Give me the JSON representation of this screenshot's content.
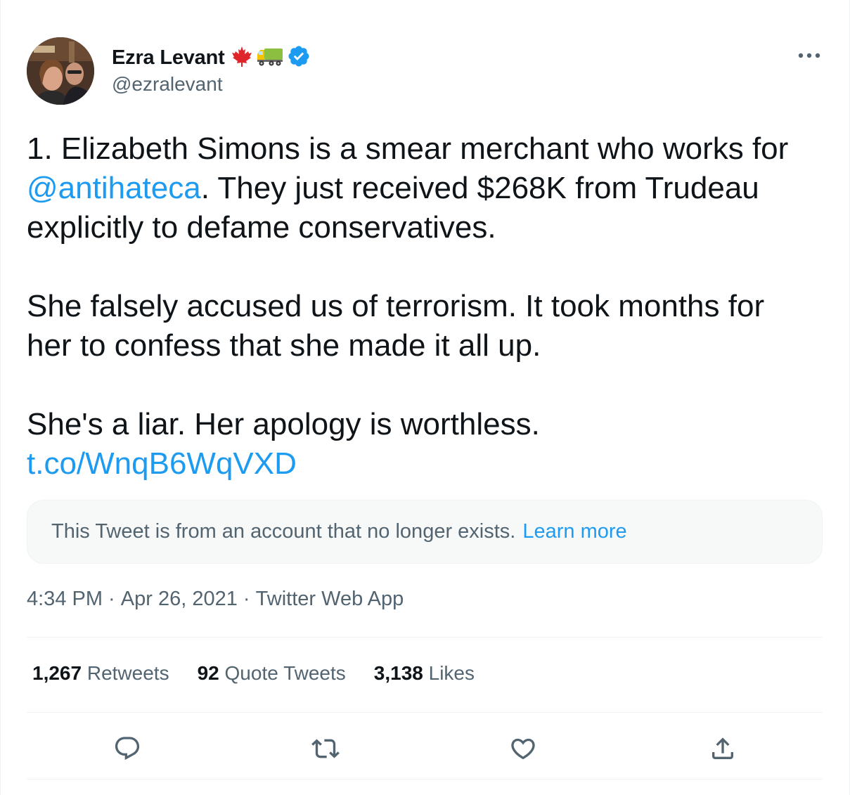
{
  "author": {
    "display_name": "Ezra Levant",
    "handle": "@ezralevant",
    "badges": [
      "maple-leaf-icon",
      "truck-icon",
      "verified-icon"
    ]
  },
  "tweet": {
    "line1": "1. Elizabeth Simons is a smear merchant who works for",
    "mention": "@antihateca",
    "line2_rest": ". They just received $268K from Trudeau",
    "line3": "explicitly to defame conservatives.",
    "para2_line1": "She falsely accused us of terrorism. It took months for",
    "para2_line2": "her to confess that she made it all up.",
    "para3_line1": "She's a liar. Her apology is worthless.",
    "link": "t.co/WnqB6WqVXD"
  },
  "quoted_notice": {
    "text": "This Tweet is from an account that no longer exists.",
    "learn_more": "Learn more"
  },
  "meta": {
    "time": "4:34 PM",
    "separator": " · ",
    "date": "Apr 26, 2021",
    "source": "Twitter Web App"
  },
  "stats": {
    "retweets_count": "1,267",
    "retweets_label": "Retweets",
    "quotes_count": "92",
    "quotes_label": "Quote Tweets",
    "likes_count": "3,138",
    "likes_label": "Likes"
  },
  "colors": {
    "accent": "#1d9bf0",
    "secondary_text": "#536471",
    "primary_text": "#0f1419",
    "divider": "#eff3f4"
  }
}
